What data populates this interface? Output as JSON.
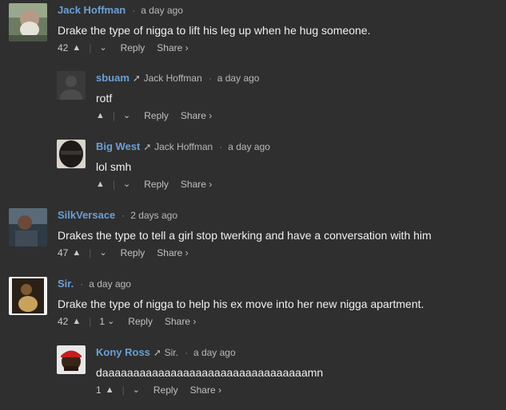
{
  "comments": [
    {
      "author": "Jack Hoffman",
      "time": "a day ago",
      "text": "Drake the type of nigga to lift his leg up when he hug someone.",
      "upvotes": "42",
      "downvotes": "",
      "reply_label": "Reply",
      "share_label": "Share ›",
      "avatar_icon": "avatar-old-man-beard"
    },
    {
      "author": "sbuam",
      "reply_to": "Jack Hoffman",
      "time": "a day ago",
      "text": "rotf",
      "upvotes": "",
      "downvotes": "",
      "reply_label": "Reply",
      "share_label": "Share ›",
      "avatar_icon": "avatar-default-silhouette"
    },
    {
      "author": "Big West",
      "reply_to": "Jack Hoffman",
      "time": "a day ago",
      "text": "lol smh",
      "upvotes": "",
      "downvotes": "",
      "reply_label": "Reply",
      "share_label": "Share ›",
      "avatar_icon": "avatar-dark-face"
    },
    {
      "author": "SilkVersace",
      "time": "2 days ago",
      "text": "Drakes the type to tell a girl stop twerking and have a conversation with him",
      "upvotes": "47",
      "downvotes": "",
      "reply_label": "Reply",
      "share_label": "Share ›",
      "avatar_icon": "avatar-photo-person"
    },
    {
      "author": "Sir.",
      "time": "a day ago",
      "text": "Drake the type of nigga to help his ex move into her new nigga apartment.",
      "upvotes": "42",
      "downvotes": "1",
      "reply_label": "Reply",
      "share_label": "Share ›",
      "avatar_icon": "avatar-dim-photo"
    },
    {
      "author": "Kony Ross",
      "reply_to": "Sir.",
      "time": "a day ago",
      "text": "daaaaaaaaaaaaaaaaaaaaaaaaaaaaaaaaamn",
      "upvotes": "1",
      "downvotes": "",
      "reply_label": "Reply",
      "share_label": "Share ›",
      "avatar_icon": "avatar-red-cap"
    }
  ],
  "colors": {
    "background": "#2f2f2f",
    "author": "#6c9fd6",
    "text": "#f0f0f0",
    "muted": "#b9b9b9"
  }
}
